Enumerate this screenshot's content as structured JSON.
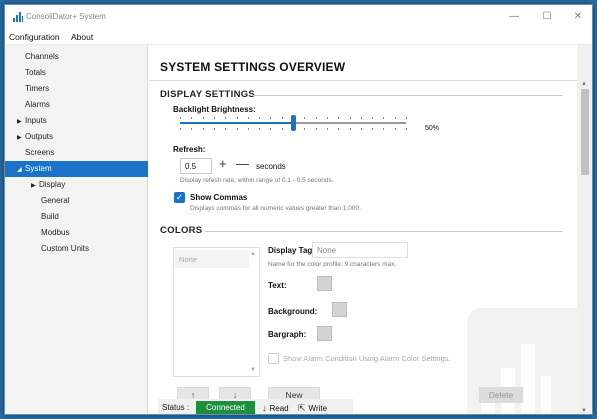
{
  "window": {
    "title": "ConsoliDator+ System",
    "controls": {
      "minimize": "—",
      "maximize": "☐",
      "close": "✕"
    }
  },
  "menu": {
    "items": [
      "Configuration",
      "About"
    ]
  },
  "sidebar": {
    "items": [
      {
        "label": "Channels",
        "arrow": ""
      },
      {
        "label": "Totals",
        "arrow": ""
      },
      {
        "label": "Timers",
        "arrow": ""
      },
      {
        "label": "Alarms",
        "arrow": ""
      },
      {
        "label": "Inputs",
        "arrow": "▶"
      },
      {
        "label": "Outputs",
        "arrow": "▶"
      },
      {
        "label": "Screens",
        "arrow": ""
      },
      {
        "label": "System",
        "arrow": "◢",
        "selected": true
      },
      {
        "label": "Display",
        "arrow": "▶"
      },
      {
        "label": "General",
        "arrow": ""
      },
      {
        "label": "Build",
        "arrow": ""
      },
      {
        "label": "Modbus",
        "arrow": ""
      },
      {
        "label": "Custom Units",
        "arrow": ""
      }
    ]
  },
  "main": {
    "page_title": "SYSTEM SETTINGS OVERVIEW",
    "display_settings": {
      "heading": "DISPLAY SETTINGS",
      "brightness_label": "Backlight Brightness:",
      "brightness_value": 0.5,
      "brightness_text": "50%",
      "refresh_label": "Refresh:",
      "refresh_value": "0.5",
      "plus": "+",
      "minus": "—",
      "refresh_unit": "seconds",
      "refresh_hint": "Display refesh rate, within range of 0.1 - 0.5 seconds.",
      "show_commas_label": "Show Commas",
      "show_commas_checked": true,
      "show_commas_hint": "Displays commas for all numeric values greater than 1,000."
    },
    "colors": {
      "heading": "COLORS",
      "list_items": [
        "None"
      ],
      "display_tag_label": "Display Tag:",
      "display_tag_value": "None",
      "display_tag_hint": "Name for the color profile. 9 characters max.",
      "text_label": "Text:",
      "background_label": "Background:",
      "bargraph_label": "Bargraph:",
      "alarm_condition_label": "Show Alarm Condition Using Alarm Color Settings.",
      "alarm_condition_checked": false,
      "up_arrow": "↑",
      "down_arrow": "↓",
      "new_label": "New",
      "delete_label": "Delete"
    }
  },
  "status": {
    "label": "Status :",
    "state": "Connected",
    "state_color": "#1e8f3e",
    "read_label": "Read",
    "write_label": "Write"
  },
  "colors": {
    "accent": "#1a73c8",
    "connected": "#1e8f3e"
  }
}
